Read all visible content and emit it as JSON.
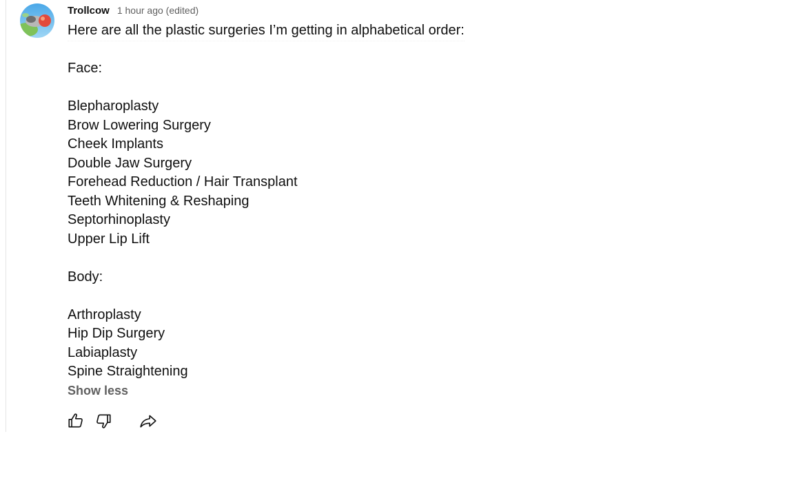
{
  "comment": {
    "author": "Trollcow",
    "timestamp": "1 hour ago (edited)",
    "lines": [
      "Here are all the plastic surgeries I’m getting in alphabetical order:",
      "",
      "Face:",
      "",
      "Blepharoplasty",
      "Brow Lowering Surgery",
      "Cheek Implants",
      "Double Jaw Surgery",
      "Forehead Reduction / Hair Transplant",
      "Teeth Whitening & Reshaping",
      "Septorhinoplasty",
      "Upper Lip Lift",
      "",
      "Body:",
      "",
      "Arthroplasty",
      "Hip Dip Surgery",
      "Labiaplasty",
      "Spine Straightening"
    ],
    "show_less_label": "Show less"
  },
  "actions": {
    "like_icon": "thumbs-up-icon",
    "dislike_icon": "thumbs-down-icon",
    "share_icon": "share-icon"
  }
}
